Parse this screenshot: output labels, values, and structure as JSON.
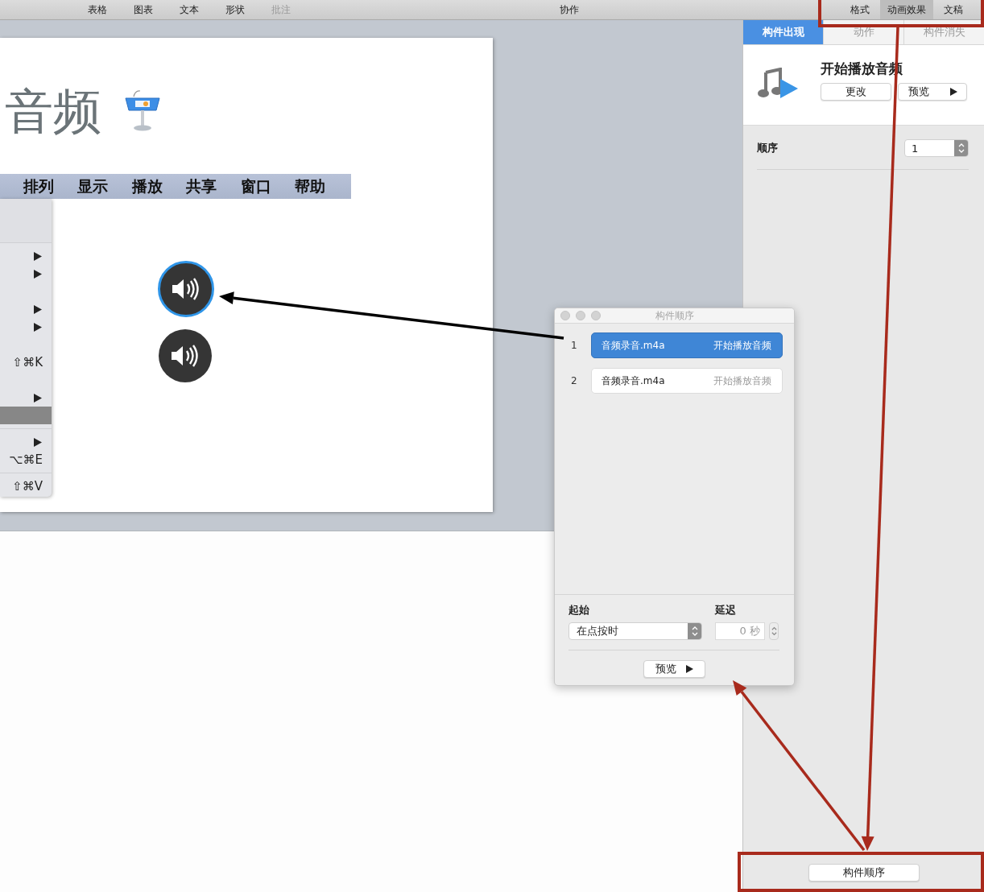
{
  "toolbar": {
    "tools": [
      {
        "label": "表格",
        "disabled": false
      },
      {
        "label": "图表",
        "disabled": false
      },
      {
        "label": "文本",
        "disabled": false
      },
      {
        "label": "形状",
        "disabled": false
      },
      {
        "label": "批注",
        "disabled": true
      }
    ],
    "collaborate": "协作",
    "inspector_tabs": [
      {
        "label": "格式",
        "selected": false
      },
      {
        "label": "动画效果",
        "selected": true
      },
      {
        "label": "文稿",
        "selected": false
      }
    ]
  },
  "slide": {
    "title": "音频",
    "menu_bar": [
      "排列",
      "显示",
      "播放",
      "共享",
      "窗口",
      "帮助"
    ],
    "menu_rows": [
      {
        "kind": "submenu",
        "selected": false
      },
      {
        "kind": "submenu",
        "selected": false
      },
      {
        "kind": "blank",
        "selected": false
      },
      {
        "kind": "submenu",
        "selected": false
      },
      {
        "kind": "submenu",
        "selected": false
      },
      {
        "kind": "blank",
        "selected": false
      },
      {
        "kind": "shortcut",
        "shortcut": "⇧⌘K",
        "selected": false
      },
      {
        "kind": "blank",
        "selected": false
      },
      {
        "kind": "submenu",
        "selected": false
      },
      {
        "kind": "blank",
        "selected": true
      },
      {
        "kind": "separator"
      },
      {
        "kind": "submenu",
        "selected": false
      },
      {
        "kind": "shortcut",
        "shortcut": "⌥⌘E",
        "selected": false
      },
      {
        "kind": "separator"
      },
      {
        "kind": "shortcut",
        "shortcut": "⇧⌘V",
        "selected": false
      }
    ],
    "audio_objects": [
      {
        "selected": true
      },
      {
        "selected": false
      }
    ]
  },
  "inspector": {
    "tabs": [
      {
        "label": "构件出现",
        "selected": true
      },
      {
        "label": "动作",
        "selected": false
      },
      {
        "label": "构件消失",
        "selected": false
      }
    ],
    "effect_title": "开始播放音频",
    "change_button": "更改",
    "preview_button": "预览",
    "order_label": "顺序",
    "order_value": "1",
    "build_order_button": "构件顺序"
  },
  "build_order_window": {
    "title": "构件顺序",
    "builds": [
      {
        "number": "1",
        "object": "音频录音.m4a",
        "effect": "开始播放音频",
        "selected": true
      },
      {
        "number": "2",
        "object": "音频录音.m4a",
        "effect": "开始播放音频",
        "selected": false
      }
    ],
    "start_label": "起始",
    "start_value": "在点按时",
    "delay_label": "延迟",
    "delay_value": "0 秒",
    "preview_button": "预览"
  }
}
